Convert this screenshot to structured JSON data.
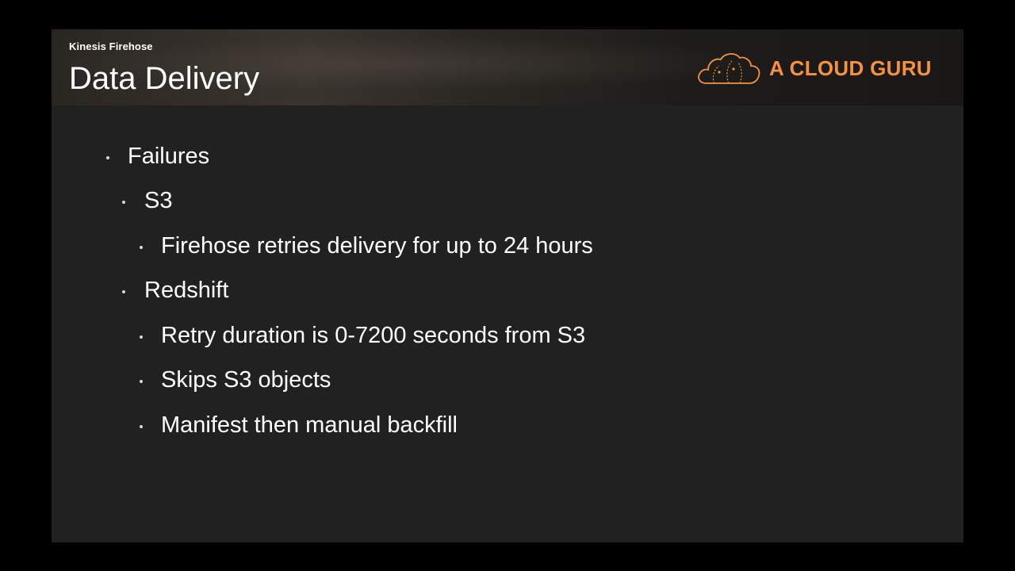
{
  "header": {
    "section_label": "Kinesis Firehose",
    "title": "Data Delivery"
  },
  "logo": {
    "text": "A CLOUD GURU",
    "icon": "cloud-icon",
    "color": "#f7923a"
  },
  "bullets": [
    {
      "level": 1,
      "text": "Failures"
    },
    {
      "level": 2,
      "text": "S3"
    },
    {
      "level": 3,
      "text": "Firehose retries delivery for up to 24 hours"
    },
    {
      "level": 2,
      "text": "Redshift"
    },
    {
      "level": 3,
      "text": "Retry duration is 0-7200 seconds from S3"
    },
    {
      "level": 3,
      "text": "Skips S3 objects"
    },
    {
      "level": 3,
      "text": "Manifest then manual backfill"
    }
  ],
  "colors": {
    "background": "#000000",
    "slide": "#212121",
    "text": "#ffffff",
    "accent": "#f7923a"
  }
}
